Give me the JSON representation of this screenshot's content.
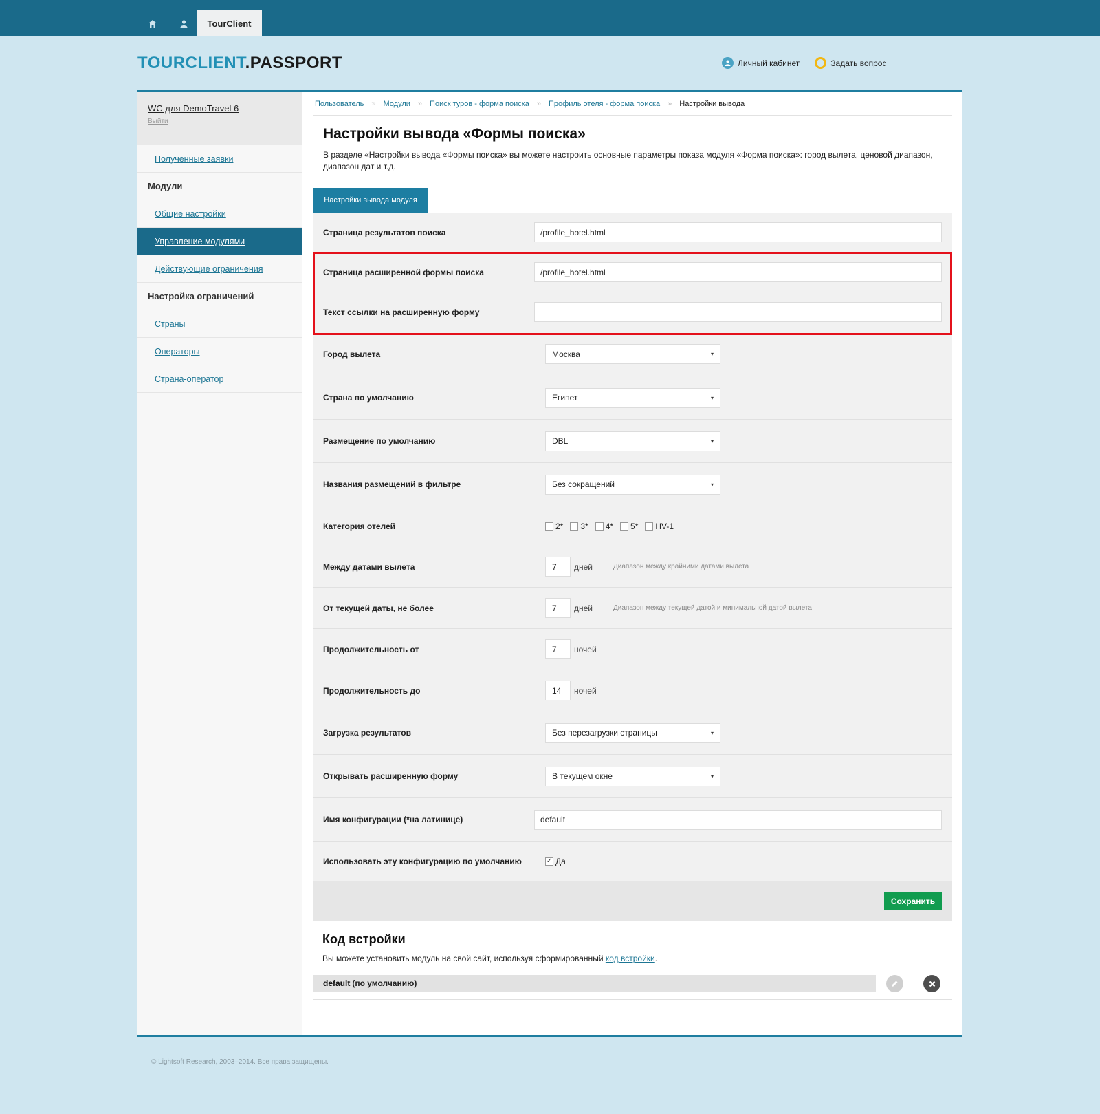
{
  "topbar": {
    "active_tab": "TourClient"
  },
  "header": {
    "logo_part1": "TOURCLIENT",
    "logo_part2": ".PASSPORT",
    "cabinet_link": "Личный кабинет",
    "ask_link": "Задать вопрос"
  },
  "sidebar": {
    "account_name": "WC для DemoTravel 6",
    "logout": "Выйти",
    "items": [
      {
        "type": "link",
        "label": "Полученные заявки"
      },
      {
        "type": "head",
        "label": "Модули"
      },
      {
        "type": "link",
        "label": "Общие настройки"
      },
      {
        "type": "link",
        "label": "Управление модулями",
        "active": true
      },
      {
        "type": "link",
        "label": "Действующие ограничения"
      },
      {
        "type": "head",
        "label": "Настройка ограничений"
      },
      {
        "type": "link",
        "label": "Страны"
      },
      {
        "type": "link",
        "label": "Операторы"
      },
      {
        "type": "link",
        "label": "Страна-оператор"
      }
    ]
  },
  "breadcrumb": {
    "items": [
      "Пользователь",
      "Модули",
      "Поиск туров - форма поиска",
      "Профиль отеля - форма поиска"
    ],
    "current": "Настройки вывода"
  },
  "page": {
    "title": "Настройки вывода «Формы поиска»",
    "description": "В разделе «Настройки вывода «Формы поиска» вы можете настроить основные параметры показа модуля «Форма поиска»: город вылета, ценовой диапазон, диапазон дат и т.д.",
    "tab": "Настройки вывода модуля"
  },
  "form": {
    "results_page": {
      "label": "Страница результатов поиска",
      "value": "/profile_hotel.html"
    },
    "ext_form_page": {
      "label": "Страница расширенной формы поиска",
      "value": "/profile_hotel.html"
    },
    "ext_link_text": {
      "label": "Текст ссылки на расширенную форму",
      "value": ""
    },
    "departure_city": {
      "label": "Город вылета",
      "value": "Москва"
    },
    "default_country": {
      "label": "Страна по умолчанию",
      "value": "Египет"
    },
    "default_accommodation": {
      "label": "Размещение по умолчанию",
      "value": "DBL"
    },
    "accommodation_names": {
      "label": "Названия размещений в фильтре",
      "value": "Без сокращений"
    },
    "hotel_category": {
      "label": "Категория отелей",
      "options": [
        {
          "label": "2*",
          "checked": false
        },
        {
          "label": "3*",
          "checked": false
        },
        {
          "label": "4*",
          "checked": false
        },
        {
          "label": "5*",
          "checked": false
        },
        {
          "label": "HV-1",
          "checked": false
        }
      ]
    },
    "between_dates": {
      "label": "Между датами вылета",
      "value": "7",
      "unit": "дней",
      "hint": "Диапазон между крайними датами вылета"
    },
    "from_current": {
      "label": "От текущей даты, не более",
      "value": "7",
      "unit": "дней",
      "hint": "Диапазон между текущей датой и минимальной датой вылета"
    },
    "duration_from": {
      "label": "Продолжительность от",
      "value": "7",
      "unit": "ночей"
    },
    "duration_to": {
      "label": "Продолжительность до",
      "value": "14",
      "unit": "ночей"
    },
    "results_loading": {
      "label": "Загрузка результатов",
      "value": "Без перезагрузки страницы"
    },
    "open_ext_form": {
      "label": "Открывать расширенную форму",
      "value": "В текущем окне"
    },
    "config_name": {
      "label": "Имя конфигурации (*на латинице)",
      "value": "default"
    },
    "use_default": {
      "label": "Использовать эту конфигурацию по умолчанию",
      "option": "Да",
      "checked": true
    },
    "save_label": "Сохранить"
  },
  "embed": {
    "title": "Код встройки",
    "desc_before": "Вы можете установить модуль на свой сайт, используя сформированный",
    "desc_link": "код встройки",
    "desc_after": ".",
    "config_link": "default",
    "config_suffix": "(по умолчанию)"
  },
  "footer": {
    "text": "© Lightsoft Research, 2003–2014. Все права защищены."
  }
}
